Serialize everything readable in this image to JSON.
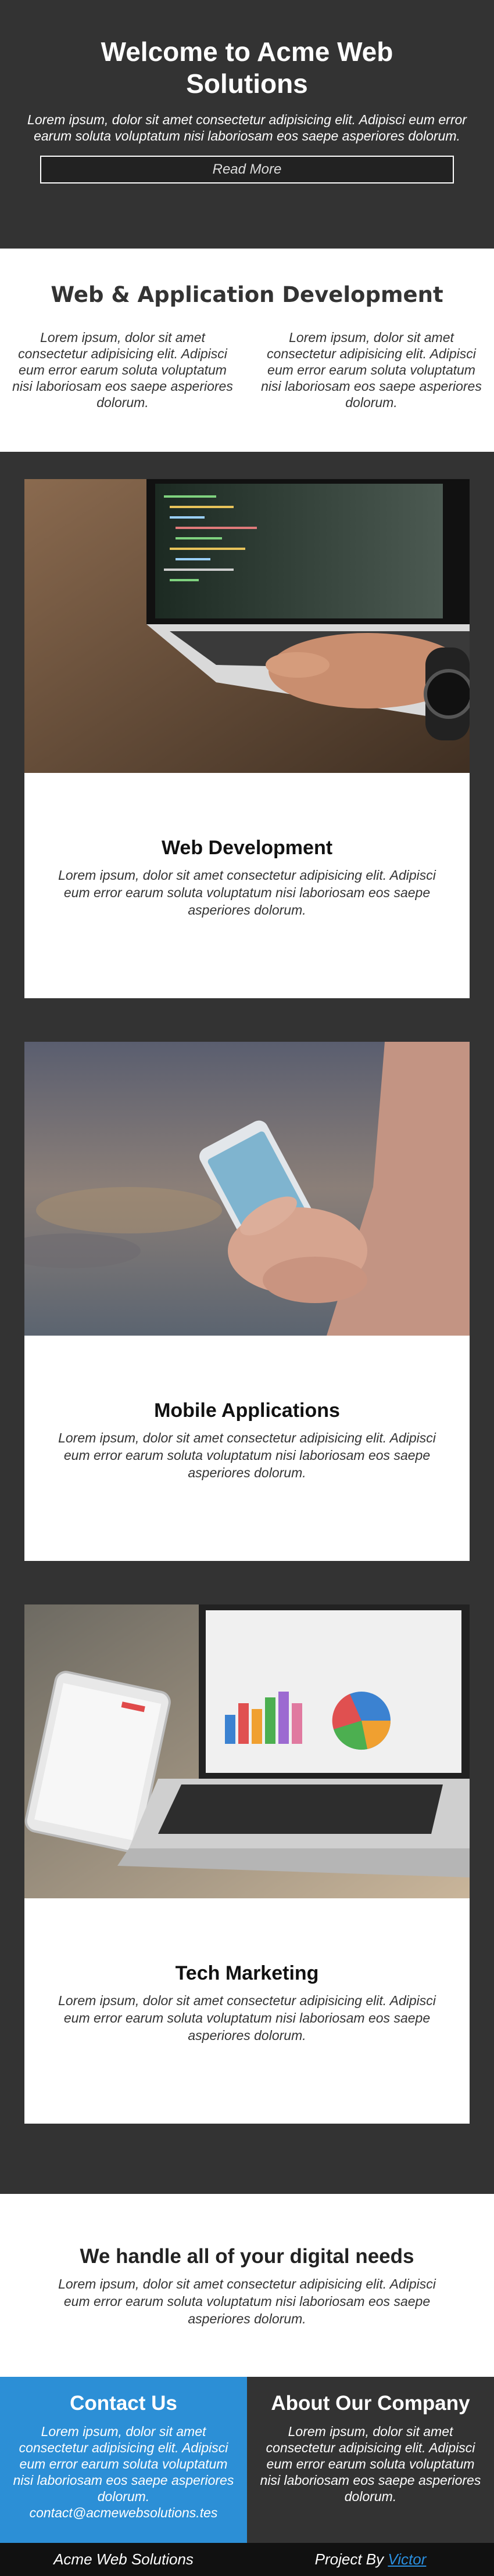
{
  "hero": {
    "title": "Welcome to Acme Web Solutions",
    "text": "Lorem ipsum, dolor sit amet consectetur adipisicing elit. Adipisci eum error earum soluta voluptatum nisi laboriosam eos saepe asperiores dolorum.",
    "button": "Read More"
  },
  "intro": {
    "title": "Web & Application Development",
    "col1": "Lorem ipsum, dolor sit amet consectetur adipisicing elit. Adipisci eum error earum soluta voluptatum nisi laboriosam eos saepe asperiores dolorum.",
    "col2": "Lorem ipsum, dolor sit amet consectetur adipisicing elit. Adipisci eum error earum soluta voluptatum nisi laboriosam eos saepe asperiores dolorum."
  },
  "services": [
    {
      "title": "Web Development",
      "text": "Lorem ipsum, dolor sit amet consectetur adipisicing elit. Adipisci eum error earum soluta voluptatum nisi laboriosam eos saepe asperiores dolorum.",
      "image": "laptop-coding-photo"
    },
    {
      "title": "Mobile Applications",
      "text": "Lorem ipsum, dolor sit amet consectetur adipisicing elit. Adipisci eum error earum soluta voluptatum nisi laboriosam eos saepe asperiores dolorum.",
      "image": "smartphone-hand-photo"
    },
    {
      "title": "Tech Marketing",
      "text": "Lorem ipsum, dolor sit amet consectetur adipisicing elit. Adipisci eum error earum soluta voluptatum nisi laboriosam eos saepe asperiores dolorum.",
      "image": "laptop-charts-photo"
    }
  ],
  "needs": {
    "title": "We handle all of your digital needs",
    "text": "Lorem ipsum, dolor sit amet consectetur adipisicing elit. Adipisci eum error earum soluta voluptatum nisi laboriosam eos saepe asperiores dolorum."
  },
  "contact": {
    "title": "Contact Us",
    "text": "Lorem ipsum, dolor sit amet consectetur adipisicing elit. Adipisci eum error earum soluta voluptatum nisi laboriosam eos saepe asperiores dolorum.",
    "email": "contact@acmewebsolutions.tes"
  },
  "about": {
    "title": "About Our Company",
    "text": "Lorem ipsum, dolor sit amet consectetur adipisicing elit. Adipisci eum error earum soluta voluptatum nisi laboriosam eos saepe asperiores dolorum."
  },
  "footer": {
    "brand": "Acme Web Solutions",
    "project_prefix": "Project By",
    "author": "Victor"
  },
  "colors": {
    "dark": "#333333",
    "blue": "#2c8fd6",
    "black": "#111111",
    "link": "#2a8fe0"
  }
}
